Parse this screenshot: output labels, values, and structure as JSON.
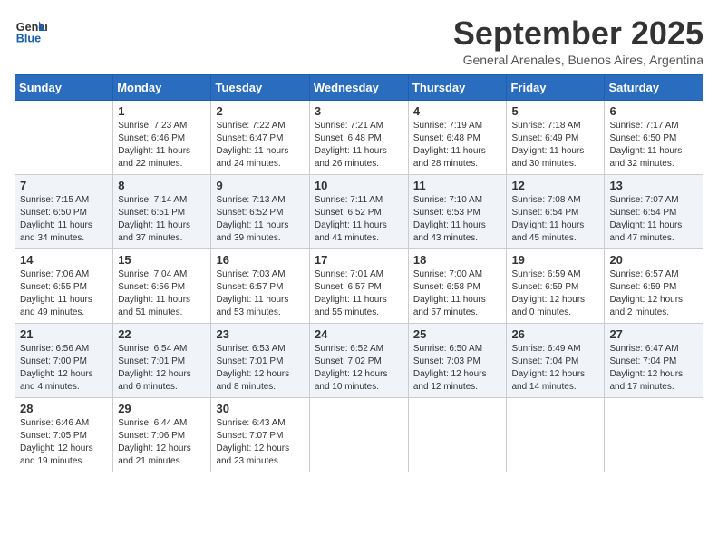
{
  "logo": {
    "line1": "General",
    "line2": "Blue"
  },
  "title": "September 2025",
  "subtitle": "General Arenales, Buenos Aires, Argentina",
  "days_of_week": [
    "Sunday",
    "Monday",
    "Tuesday",
    "Wednesday",
    "Thursday",
    "Friday",
    "Saturday"
  ],
  "weeks": [
    [
      {
        "day": "",
        "info": ""
      },
      {
        "day": "1",
        "info": "Sunrise: 7:23 AM\nSunset: 6:46 PM\nDaylight: 11 hours\nand 22 minutes."
      },
      {
        "day": "2",
        "info": "Sunrise: 7:22 AM\nSunset: 6:47 PM\nDaylight: 11 hours\nand 24 minutes."
      },
      {
        "day": "3",
        "info": "Sunrise: 7:21 AM\nSunset: 6:48 PM\nDaylight: 11 hours\nand 26 minutes."
      },
      {
        "day": "4",
        "info": "Sunrise: 7:19 AM\nSunset: 6:48 PM\nDaylight: 11 hours\nand 28 minutes."
      },
      {
        "day": "5",
        "info": "Sunrise: 7:18 AM\nSunset: 6:49 PM\nDaylight: 11 hours\nand 30 minutes."
      },
      {
        "day": "6",
        "info": "Sunrise: 7:17 AM\nSunset: 6:50 PM\nDaylight: 11 hours\nand 32 minutes."
      }
    ],
    [
      {
        "day": "7",
        "info": "Sunrise: 7:15 AM\nSunset: 6:50 PM\nDaylight: 11 hours\nand 34 minutes."
      },
      {
        "day": "8",
        "info": "Sunrise: 7:14 AM\nSunset: 6:51 PM\nDaylight: 11 hours\nand 37 minutes."
      },
      {
        "day": "9",
        "info": "Sunrise: 7:13 AM\nSunset: 6:52 PM\nDaylight: 11 hours\nand 39 minutes."
      },
      {
        "day": "10",
        "info": "Sunrise: 7:11 AM\nSunset: 6:52 PM\nDaylight: 11 hours\nand 41 minutes."
      },
      {
        "day": "11",
        "info": "Sunrise: 7:10 AM\nSunset: 6:53 PM\nDaylight: 11 hours\nand 43 minutes."
      },
      {
        "day": "12",
        "info": "Sunrise: 7:08 AM\nSunset: 6:54 PM\nDaylight: 11 hours\nand 45 minutes."
      },
      {
        "day": "13",
        "info": "Sunrise: 7:07 AM\nSunset: 6:54 PM\nDaylight: 11 hours\nand 47 minutes."
      }
    ],
    [
      {
        "day": "14",
        "info": "Sunrise: 7:06 AM\nSunset: 6:55 PM\nDaylight: 11 hours\nand 49 minutes."
      },
      {
        "day": "15",
        "info": "Sunrise: 7:04 AM\nSunset: 6:56 PM\nDaylight: 11 hours\nand 51 minutes."
      },
      {
        "day": "16",
        "info": "Sunrise: 7:03 AM\nSunset: 6:57 PM\nDaylight: 11 hours\nand 53 minutes."
      },
      {
        "day": "17",
        "info": "Sunrise: 7:01 AM\nSunset: 6:57 PM\nDaylight: 11 hours\nand 55 minutes."
      },
      {
        "day": "18",
        "info": "Sunrise: 7:00 AM\nSunset: 6:58 PM\nDaylight: 11 hours\nand 57 minutes."
      },
      {
        "day": "19",
        "info": "Sunrise: 6:59 AM\nSunset: 6:59 PM\nDaylight: 12 hours\nand 0 minutes."
      },
      {
        "day": "20",
        "info": "Sunrise: 6:57 AM\nSunset: 6:59 PM\nDaylight: 12 hours\nand 2 minutes."
      }
    ],
    [
      {
        "day": "21",
        "info": "Sunrise: 6:56 AM\nSunset: 7:00 PM\nDaylight: 12 hours\nand 4 minutes."
      },
      {
        "day": "22",
        "info": "Sunrise: 6:54 AM\nSunset: 7:01 PM\nDaylight: 12 hours\nand 6 minutes."
      },
      {
        "day": "23",
        "info": "Sunrise: 6:53 AM\nSunset: 7:01 PM\nDaylight: 12 hours\nand 8 minutes."
      },
      {
        "day": "24",
        "info": "Sunrise: 6:52 AM\nSunset: 7:02 PM\nDaylight: 12 hours\nand 10 minutes."
      },
      {
        "day": "25",
        "info": "Sunrise: 6:50 AM\nSunset: 7:03 PM\nDaylight: 12 hours\nand 12 minutes."
      },
      {
        "day": "26",
        "info": "Sunrise: 6:49 AM\nSunset: 7:04 PM\nDaylight: 12 hours\nand 14 minutes."
      },
      {
        "day": "27",
        "info": "Sunrise: 6:47 AM\nSunset: 7:04 PM\nDaylight: 12 hours\nand 17 minutes."
      }
    ],
    [
      {
        "day": "28",
        "info": "Sunrise: 6:46 AM\nSunset: 7:05 PM\nDaylight: 12 hours\nand 19 minutes."
      },
      {
        "day": "29",
        "info": "Sunrise: 6:44 AM\nSunset: 7:06 PM\nDaylight: 12 hours\nand 21 minutes."
      },
      {
        "day": "30",
        "info": "Sunrise: 6:43 AM\nSunset: 7:07 PM\nDaylight: 12 hours\nand 23 minutes."
      },
      {
        "day": "",
        "info": ""
      },
      {
        "day": "",
        "info": ""
      },
      {
        "day": "",
        "info": ""
      },
      {
        "day": "",
        "info": ""
      }
    ]
  ]
}
